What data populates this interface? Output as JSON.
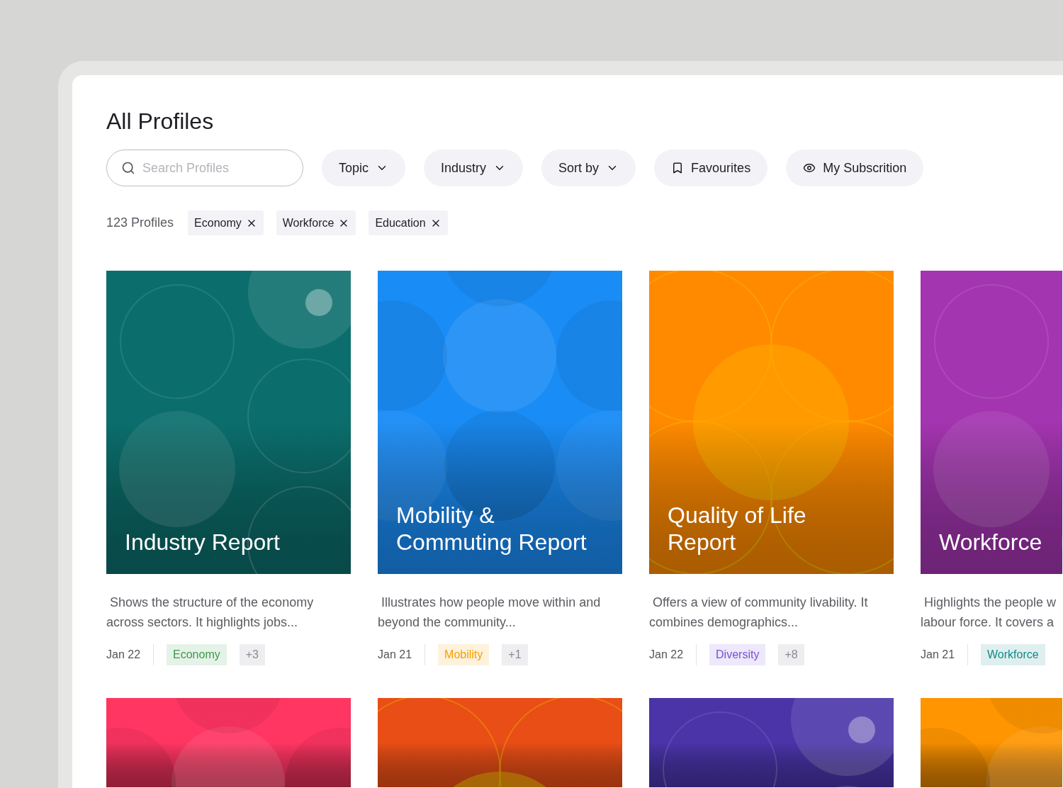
{
  "title": "All Profiles",
  "search": {
    "placeholder": "Search Profiles"
  },
  "toolbar": [
    {
      "label": "Topic",
      "kind": "dropdown"
    },
    {
      "label": "Industry",
      "kind": "dropdown"
    },
    {
      "label": "Sort by",
      "kind": "dropdown"
    },
    {
      "label": "Favourites",
      "kind": "bookmark"
    },
    {
      "label": "My Subscrition",
      "kind": "eye"
    }
  ],
  "count": "123 Profiles",
  "active_filters": [
    "Economy",
    "Workforce",
    "Education"
  ],
  "cards": [
    {
      "title_lines": [
        "Industry Report"
      ],
      "color": "#0b6e6c",
      "description_lines": [
        " Shows the structure of the economy",
        "across sectors. It highlights jobs..."
      ],
      "date": "Jan 22",
      "tag": {
        "label": "Economy",
        "color": "#3a9a4a"
      },
      "extra": "+3"
    },
    {
      "title_lines": [
        "Mobility &",
        "Commuting Report"
      ],
      "color": "#1a8cf5",
      "description_lines": [
        " Illustrates how people move within and",
        "beyond the community..."
      ],
      "date": "Jan 21",
      "tag": {
        "label": "Mobility",
        "color": "#f5a000"
      },
      "extra": "+1"
    },
    {
      "title_lines": [
        "Quality of Life",
        "Report"
      ],
      "color": "#ff8a00",
      "description_lines": [
        " Offers a view of community livability. It",
        "combines demographics..."
      ],
      "date": "Jan 22",
      "tag": {
        "label": "Diversity",
        "color": "#7a4fd6"
      },
      "extra": "+8"
    },
    {
      "title_lines": [
        "Workforce"
      ],
      "color": "#a335b0",
      "description_lines": [
        " Highlights the people w",
        "labour force. It covers a"
      ],
      "date": "Jan 21",
      "tag": {
        "label": "Workforce",
        "color": "#128a8a"
      }
    }
  ],
  "second_row": [
    {
      "color": "#ff3562"
    },
    {
      "color": "#e84e16"
    },
    {
      "color": "#4a34a8"
    },
    {
      "color": "#ff9500"
    }
  ]
}
